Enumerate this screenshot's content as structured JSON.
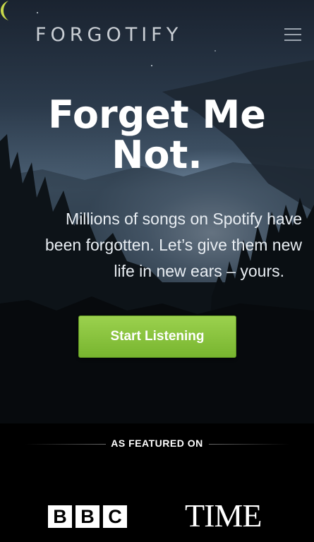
{
  "header": {
    "logo_text": "FORGOTIFY",
    "menu_icon": "hamburger-icon"
  },
  "hero": {
    "headline_line1": "Forget Me",
    "headline_line2": "Not.",
    "subtext_line1": "Millions of songs on Spotify have",
    "subtext_line2": "been forgotten. Let’s give them new",
    "subtext_line3": "life in new ears – yours.",
    "cta_label": "Start Listening"
  },
  "featured": {
    "title": "AS FEATURED ON",
    "bbc_letters": [
      "B",
      "B",
      "C"
    ],
    "time_text": "TIME"
  },
  "colors": {
    "cta_green": "#8cc63f",
    "moon_accent": "#c8d84a",
    "logo_text": "#c9ced4"
  }
}
